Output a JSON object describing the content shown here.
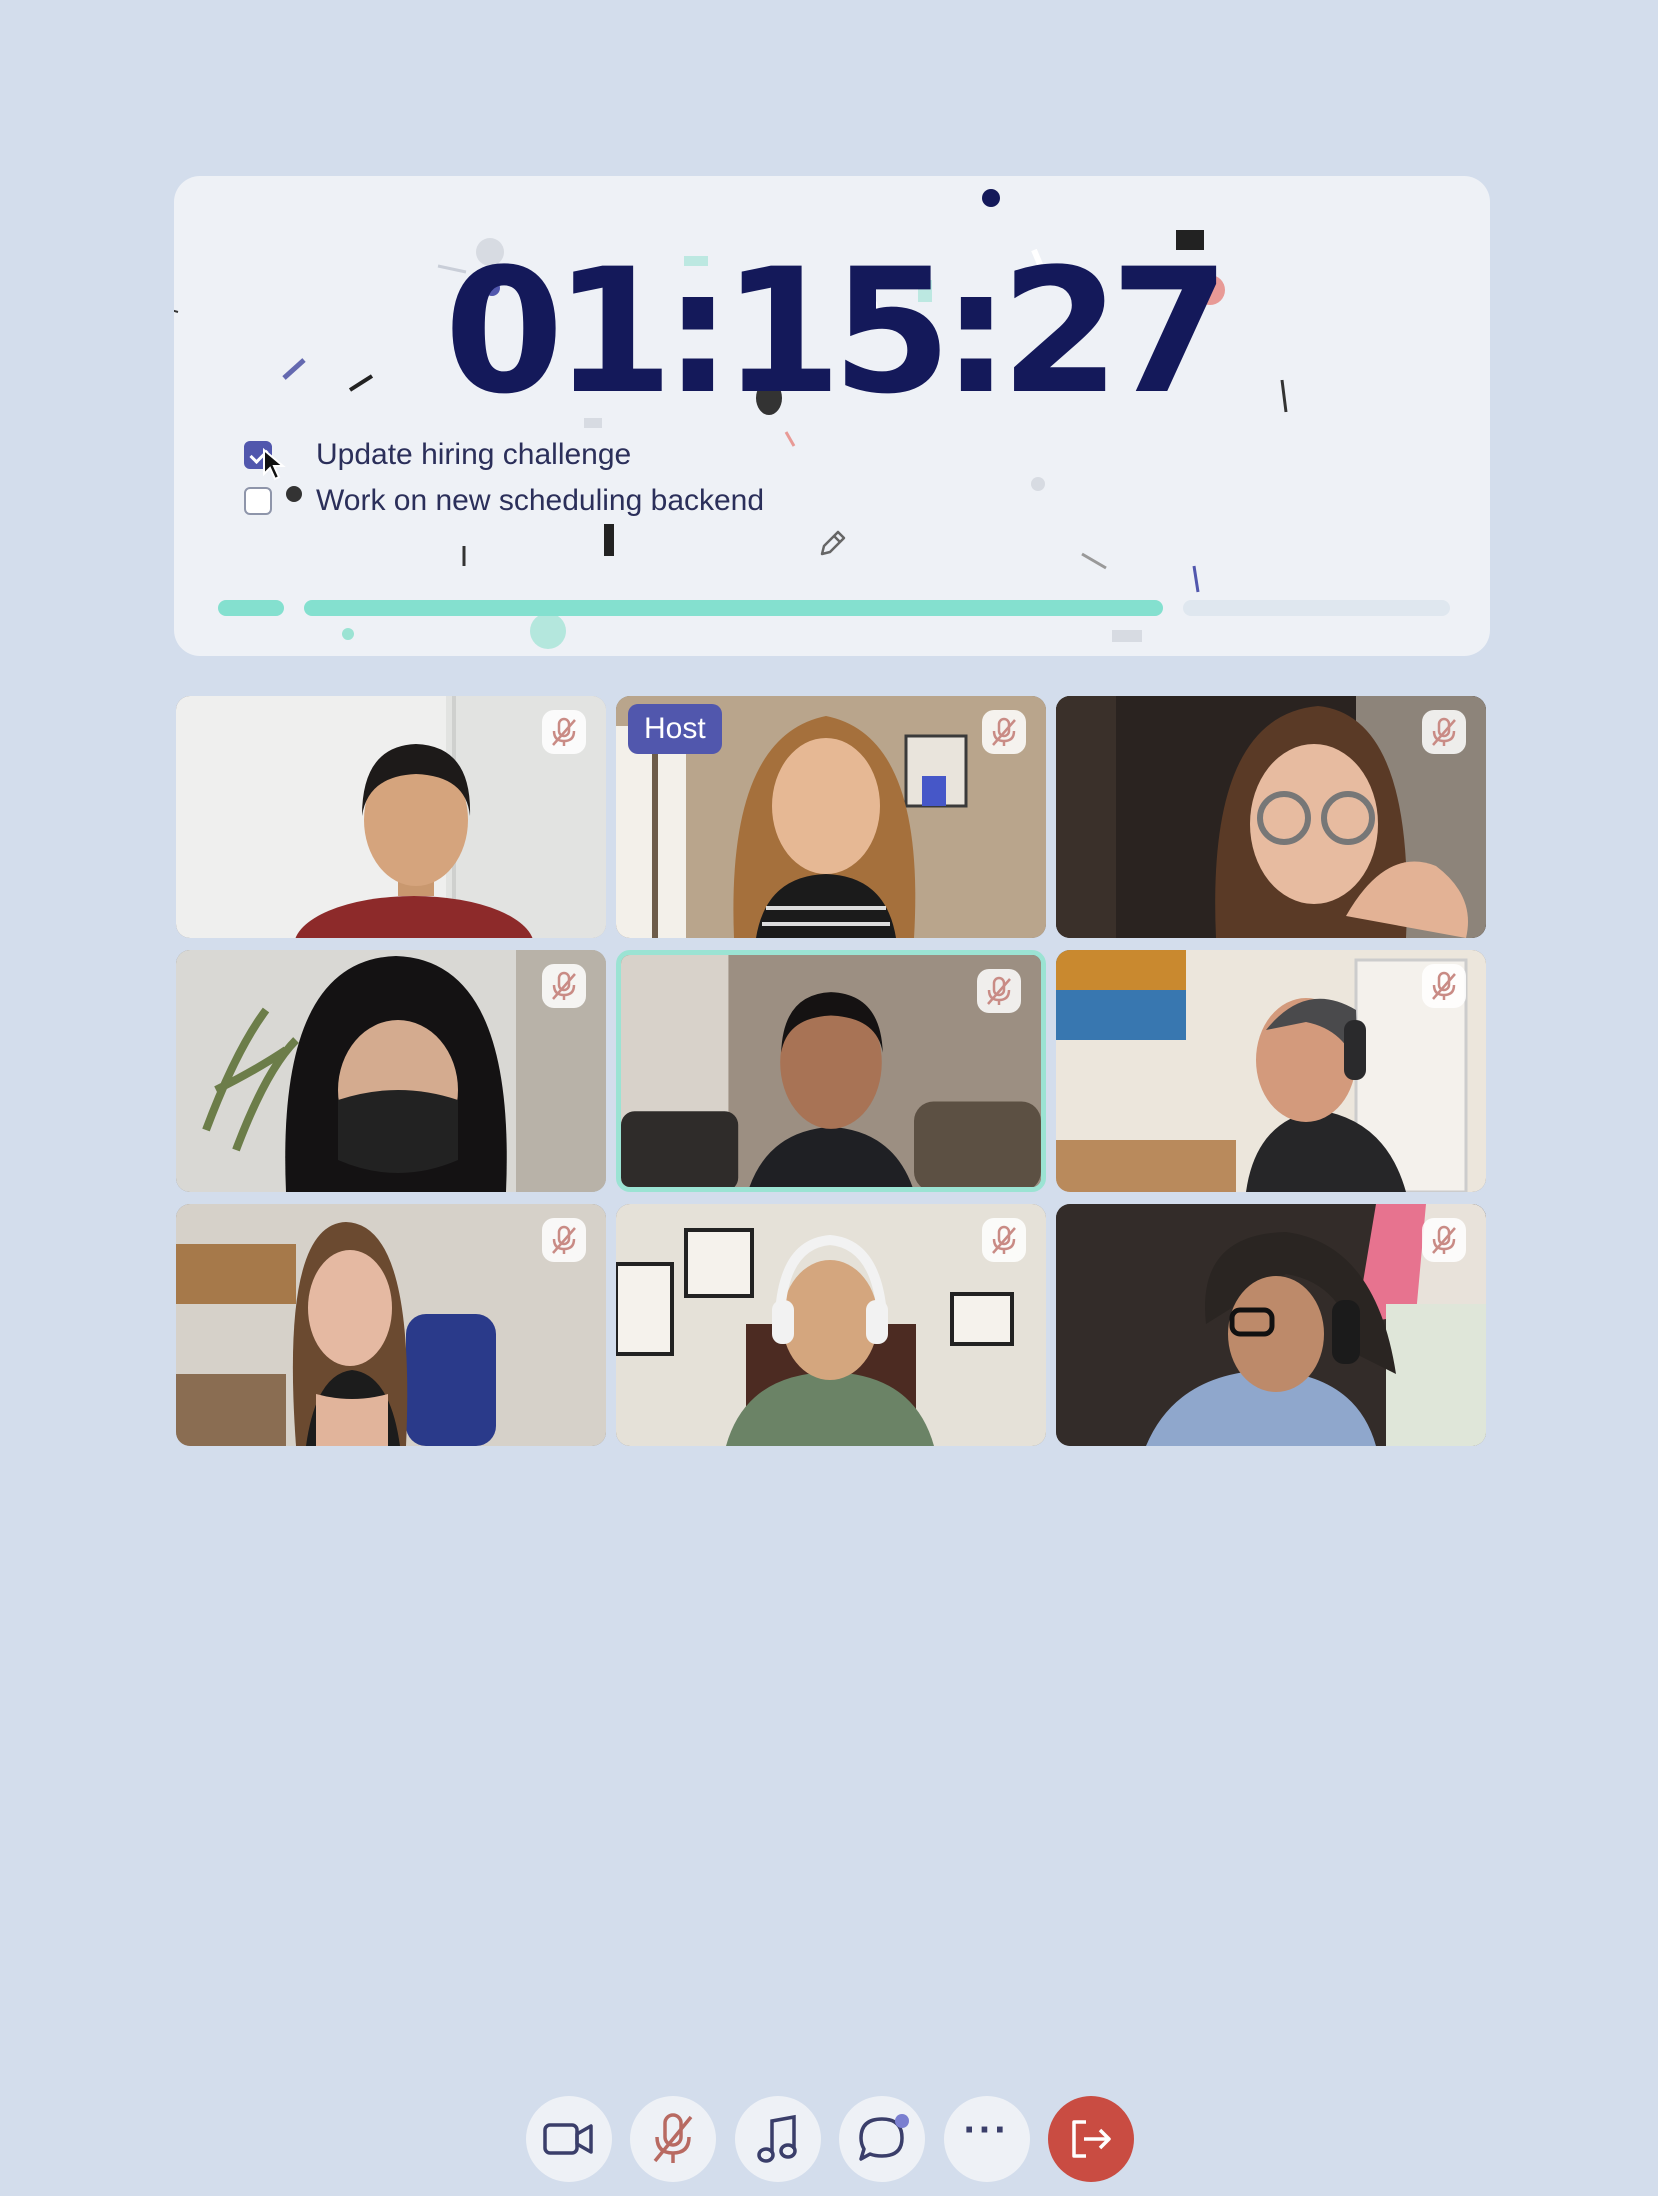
{
  "timer": {
    "value": "01:15:27",
    "progress": 0.82
  },
  "tasks": [
    {
      "label": "Update hiring challenge",
      "checked": true
    },
    {
      "label": "Work on new scheduling backend",
      "checked": false
    }
  ],
  "participants": [
    {
      "tile": 1,
      "muted": true,
      "host": false,
      "active": false
    },
    {
      "tile": 2,
      "muted": true,
      "host": true,
      "active": false
    },
    {
      "tile": 3,
      "muted": true,
      "host": false,
      "active": false
    },
    {
      "tile": 4,
      "muted": true,
      "host": false,
      "active": false
    },
    {
      "tile": 5,
      "muted": true,
      "host": false,
      "active": true
    },
    {
      "tile": 6,
      "muted": true,
      "host": false,
      "active": false
    },
    {
      "tile": 7,
      "muted": true,
      "host": false,
      "active": false
    },
    {
      "tile": 8,
      "muted": true,
      "host": false,
      "active": false
    },
    {
      "tile": 9,
      "muted": true,
      "host": false,
      "active": false
    }
  ],
  "host_label": "Host",
  "toolbar": {
    "buttons": [
      "video-camera-icon",
      "microphone-muted-icon",
      "music-note-icon",
      "chat-bubble-icon",
      "more-options-icon",
      "leave-call-icon"
    ],
    "more_label": "···"
  },
  "colors": {
    "background": "#d3ddec",
    "card": "#eef1f6",
    "timer_text": "#14195a",
    "accent": "#5157ad",
    "progress": "#84e0cf",
    "leave": "#c94c42",
    "active_border": "#9be3d3"
  }
}
